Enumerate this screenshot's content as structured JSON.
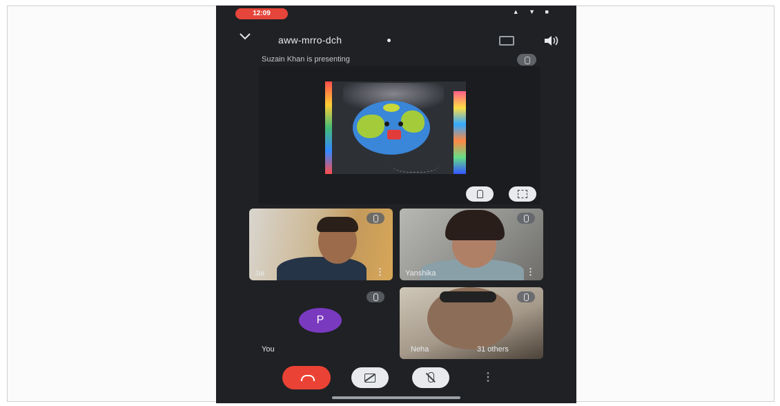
{
  "status_bar": {
    "time": "12:09",
    "icons_text": "▲ ▼ ■"
  },
  "meeting": {
    "code": "aww-mrro-dch",
    "presenting_text": "Suzain Khan is presenting"
  },
  "participants": [
    {
      "name": "Jai"
    },
    {
      "name": "Yanshika"
    },
    {
      "name": "You",
      "avatar_letter": "P",
      "avatar_color": "#7a3ac0"
    },
    {
      "name": "Neha"
    }
  ],
  "others_label": "31 others",
  "more_glyph": "⋮",
  "colors": {
    "end_call": "#ea4335",
    "background": "#202124",
    "status_time_bg": "#e5453a"
  }
}
